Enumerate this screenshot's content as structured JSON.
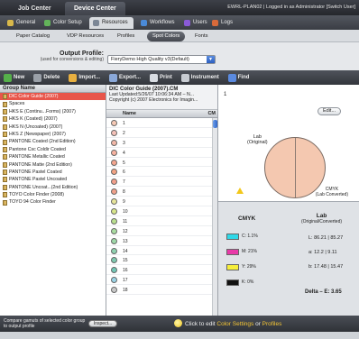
{
  "topbar": {
    "tabs": [
      "Job Center",
      "Device Center"
    ],
    "active_tab": 1,
    "user_info": "EWRL-PLAN02 | Logged in as Administrator [Switch User]"
  },
  "nav": {
    "tabs": [
      {
        "label": "General",
        "icon": "gear-icon",
        "color": "#d8b84a"
      },
      {
        "label": "Color Setup",
        "icon": "color-icon",
        "color": "#63b45a"
      },
      {
        "label": "Resources",
        "icon": "resources-icon",
        "color": "#7c8796"
      },
      {
        "label": "Workflows",
        "icon": "workflow-icon",
        "color": "#4a8ad8"
      },
      {
        "label": "Users",
        "icon": "users-icon",
        "color": "#8a5ad8"
      },
      {
        "label": "Logs",
        "icon": "logs-icon",
        "color": "#d86a3a"
      }
    ],
    "active_tab": 2
  },
  "subtabs": {
    "items": [
      "Paper Catalog",
      "VDP Resources",
      "Profiles",
      "Spot Colors",
      "Fonts"
    ],
    "active": 3
  },
  "output_profile": {
    "label": "Output Profile:",
    "sublabel": "(used for conversions & editing)",
    "value": "FieryDemo High Quality v3(Default)"
  },
  "toolbar": {
    "buttons": [
      {
        "label": "New",
        "icon": "new-icon",
        "color": "#55b04a"
      },
      {
        "label": "Delete",
        "icon": "delete-icon",
        "color": "#9aa0a8"
      },
      {
        "label": "Import...",
        "icon": "import-icon",
        "color": "#e8b040"
      },
      {
        "label": "Export...",
        "icon": "export-icon",
        "color": "#8aa8d8"
      },
      {
        "label": "Print",
        "icon": "print-icon",
        "color": "#d8dce2"
      },
      {
        "label": "Instrument",
        "icon": "instrument-icon",
        "color": "#c8ccd2"
      },
      {
        "label": "Find",
        "icon": "find-icon",
        "color": "#5a8ae0"
      }
    ]
  },
  "groups": {
    "header": "Group Name",
    "items": [
      "DIC Color Guide (2007)",
      "Spaces",
      "HKS E (Continu...Forms) (2007)",
      "HKS K (Coated) (2007)",
      "HKS N (Uncoated) (2007)",
      "HKS Z (Newspaper) (2007)",
      "PANTONE Coated (2nd Edition)",
      "Pantone Csc Coldir Coated",
      "PANTONE Metallic Coated",
      "PANTONE Matte (2nd Edition)",
      "PANTONE Pastel Coated",
      "PANTONE Pastel Uncoated",
      "PANTONE Uncoat...(2nd Edition)",
      "TOYO Color Finder (2008)",
      "TOYO 94 Color Finder"
    ],
    "selected": 0
  },
  "guide": {
    "title": "DIC Color Guide (2007).CM",
    "updated": "Last Updated:5/26/07 10:06:34 AM – N...",
    "copyright": "Copyright (c) 2007 Electronics for Imagin..."
  },
  "colors": {
    "header_name": "Name",
    "header_cm": "CM",
    "rows": [
      {
        "name": "1",
        "hex": "#f6c9b5"
      },
      {
        "name": "2",
        "hex": "#f4c1b8"
      },
      {
        "name": "3",
        "hex": "#f2b8a8"
      },
      {
        "name": "4",
        "hex": "#f7b2a0"
      },
      {
        "name": "5",
        "hex": "#f4a58e"
      },
      {
        "name": "6",
        "hex": "#f3a383"
      },
      {
        "name": "7",
        "hex": "#f29f8a"
      },
      {
        "name": "8",
        "hex": "#f0a08a"
      },
      {
        "name": "9",
        "hex": "#e6e49a"
      },
      {
        "name": "10",
        "hex": "#d7e58a"
      },
      {
        "name": "11",
        "hex": "#b9df8e"
      },
      {
        "name": "12",
        "hex": "#a9dca0"
      },
      {
        "name": "13",
        "hex": "#9ed8a8"
      },
      {
        "name": "14",
        "hex": "#8fd2b0"
      },
      {
        "name": "15",
        "hex": "#7fcab0"
      },
      {
        "name": "16",
        "hex": "#72c7b6"
      },
      {
        "name": "17",
        "hex": "#9bd4e6"
      },
      {
        "name": "18",
        "hex": "#c9c9c9"
      }
    ]
  },
  "detail": {
    "number": "1",
    "edit_label": "Edit...",
    "lab_label": "Lab",
    "lab_sub": "(Original)",
    "cmyk_label": "CMYK",
    "cmyk_sub": "(Lab Converted)",
    "swatch_color": "#f4c8b0"
  },
  "values": {
    "cmyk_title": "CMYK",
    "lab_title": "Lab",
    "lab_sub": "(Original/Converted)",
    "inks": [
      {
        "value": "C: 1.1%",
        "hex": "#2fd8e8"
      },
      {
        "value": "M: 21%",
        "hex": "#e83aa8"
      },
      {
        "value": "Y: 29%",
        "hex": "#f6ee3a"
      },
      {
        "value": "K: 0%",
        "hex": "#111111"
      }
    ],
    "lab": [
      "L: 86.21 | 85.27",
      "a: 12.2 | 9.11",
      "b: 17.48 | 15.47"
    ],
    "delta": "Delta – E: 3.65"
  },
  "footer": {
    "description": "Compare gamuts of selected color group to output profile",
    "inspect_label": "Inspect...",
    "hint_prefix": "Click to edit",
    "hint_link1": "Color Settings",
    "hint_mid": "or",
    "hint_link2": "Profiles"
  }
}
